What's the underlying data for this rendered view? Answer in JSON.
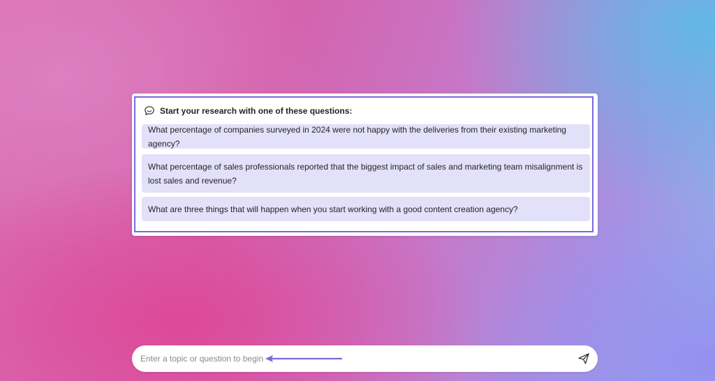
{
  "suggestions": {
    "heading": "Start your research with one of these questions:",
    "heading_icon": "chat-bubble-icon",
    "questions": [
      "What percentage of companies surveyed in 2024 were not happy with the deliveries from their existing marketing agency?",
      "What percentage of sales professionals reported that the biggest impact of sales and marketing team misalignment is lost sales and revenue?",
      "What are three things that will happen when you start working with a good content creation agency?"
    ]
  },
  "input": {
    "placeholder": "Enter a topic or question to begin",
    "send_icon": "send-icon"
  },
  "colors": {
    "accent": "#7a68e0",
    "question_bg": "#e3e0fa",
    "annotation_arrow": "#7a68e0"
  }
}
